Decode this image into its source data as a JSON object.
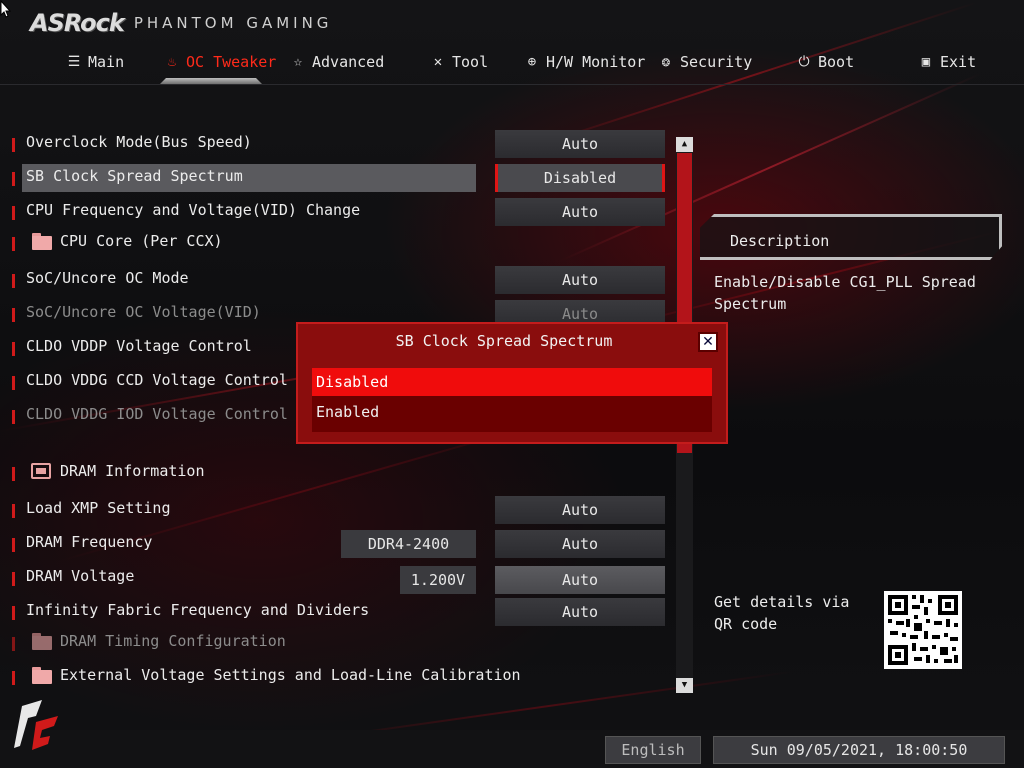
{
  "brand": {
    "logo": "ASRock",
    "subtitle": "PHANTOM GAMING"
  },
  "tabs": [
    {
      "label": "Main",
      "icon": "list-icon",
      "active": false
    },
    {
      "label": "OC Tweaker",
      "icon": "flame-icon",
      "active": true
    },
    {
      "label": "Advanced",
      "icon": "star-icon",
      "active": false
    },
    {
      "label": "Tool",
      "icon": "tools-icon",
      "active": false
    },
    {
      "label": "H/W Monitor",
      "icon": "monitor-icon",
      "active": false
    },
    {
      "label": "Security",
      "icon": "shield-icon",
      "active": false
    },
    {
      "label": "Boot",
      "icon": "power-icon",
      "active": false
    },
    {
      "label": "Exit",
      "icon": "exit-icon",
      "active": false
    }
  ],
  "settings": [
    {
      "label": "Overclock Mode(Bus Speed)",
      "value": "Auto"
    },
    {
      "label": "SB Clock Spread Spectrum",
      "value": "Disabled"
    },
    {
      "label": "CPU Frequency and Voltage(VID) Change",
      "value": "Auto"
    },
    {
      "label": "CPU Core (Per CCX)"
    },
    {
      "label": "SoC/Uncore OC Mode",
      "value": "Auto"
    },
    {
      "label": "SoC/Uncore OC Voltage(VID)",
      "value": "Auto"
    },
    {
      "label": "CLDO VDDP Voltage Control"
    },
    {
      "label": "CLDO VDDG CCD Voltage Control"
    },
    {
      "label": "CLDO VDDG IOD Voltage Control"
    },
    {
      "label": "DRAM Information"
    },
    {
      "label": "Load XMP Setting",
      "value": "Auto"
    },
    {
      "label": "DRAM Frequency",
      "info": "DDR4-2400",
      "value": "Auto"
    },
    {
      "label": "DRAM Voltage",
      "info": "1.200V",
      "value": "Auto"
    },
    {
      "label": "Infinity Fabric Frequency and Dividers",
      "value": "Auto"
    },
    {
      "label": "DRAM Timing Configuration"
    },
    {
      "label": "External Voltage Settings and Load-Line Calibration"
    }
  ],
  "description": {
    "title": "Description",
    "text": "Enable/Disable CG1_PLL Spread Spectrum",
    "qr_text": "Get details via QR code"
  },
  "modal": {
    "title": "SB Clock Spread Spectrum",
    "close": "✕",
    "options": [
      {
        "label": "Disabled",
        "selected": true
      },
      {
        "label": "Enabled",
        "selected": false
      }
    ]
  },
  "footer": {
    "language": "English",
    "datetime": "Sun 09/05/2021, 18:00:50"
  },
  "colors": {
    "accent": "#e01515",
    "highlight": "#f00c0c",
    "modal_bg": "#8a0d0d"
  }
}
